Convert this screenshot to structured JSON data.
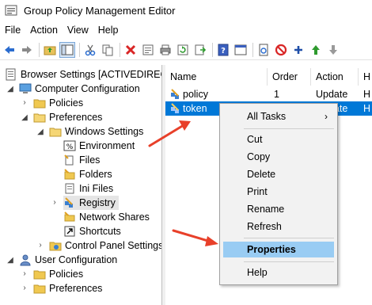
{
  "window": {
    "title": "Group Policy Management Editor"
  },
  "menubar": {
    "items": [
      "File",
      "Action",
      "View",
      "Help"
    ]
  },
  "toolbar": {
    "buttons": [
      "back-icon",
      "forward-icon",
      "up-folder-icon",
      "show-hide-tree-icon",
      "cut-icon",
      "copy-icon",
      "delete-icon",
      "properties-icon",
      "print-icon",
      "refresh-icon",
      "export-list-icon",
      "help-icon",
      "console-icon",
      "new-document-icon",
      "block-icon",
      "add-icon",
      "move-up-icon",
      "move-down-icon"
    ]
  },
  "tree": {
    "root": "Browser Settings [ACTIVEDIRECTC",
    "computer_config": "Computer Configuration",
    "cc_policies": "Policies",
    "cc_preferences": "Preferences",
    "windows_settings": "Windows Settings",
    "environment": "Environment",
    "files": "Files",
    "folders": "Folders",
    "ini_files": "Ini Files",
    "registry": "Registry",
    "network_shares": "Network Shares",
    "shortcuts": "Shortcuts",
    "control_panel_settings": "Control Panel Settings",
    "user_config": "User Configuration",
    "uc_policies": "Policies",
    "uc_preferences": "Preferences"
  },
  "list": {
    "headers": {
      "name": "Name",
      "order": "Order",
      "action": "Action",
      "extra": "H"
    },
    "rows": [
      {
        "name": "policy",
        "order": "1",
        "action": "Update",
        "extra": "H"
      },
      {
        "name": "token",
        "order": "",
        "action": "date",
        "extra": "H"
      }
    ]
  },
  "context_menu": {
    "all_tasks": "All Tasks",
    "cut": "Cut",
    "copy": "Copy",
    "delete": "Delete",
    "print": "Print",
    "rename": "Rename",
    "refresh": "Refresh",
    "properties": "Properties",
    "help": "Help"
  },
  "colors": {
    "selection": "#0078d7",
    "menu_highlight": "#99ccf3",
    "annotation_arrow": "#e8402a"
  }
}
